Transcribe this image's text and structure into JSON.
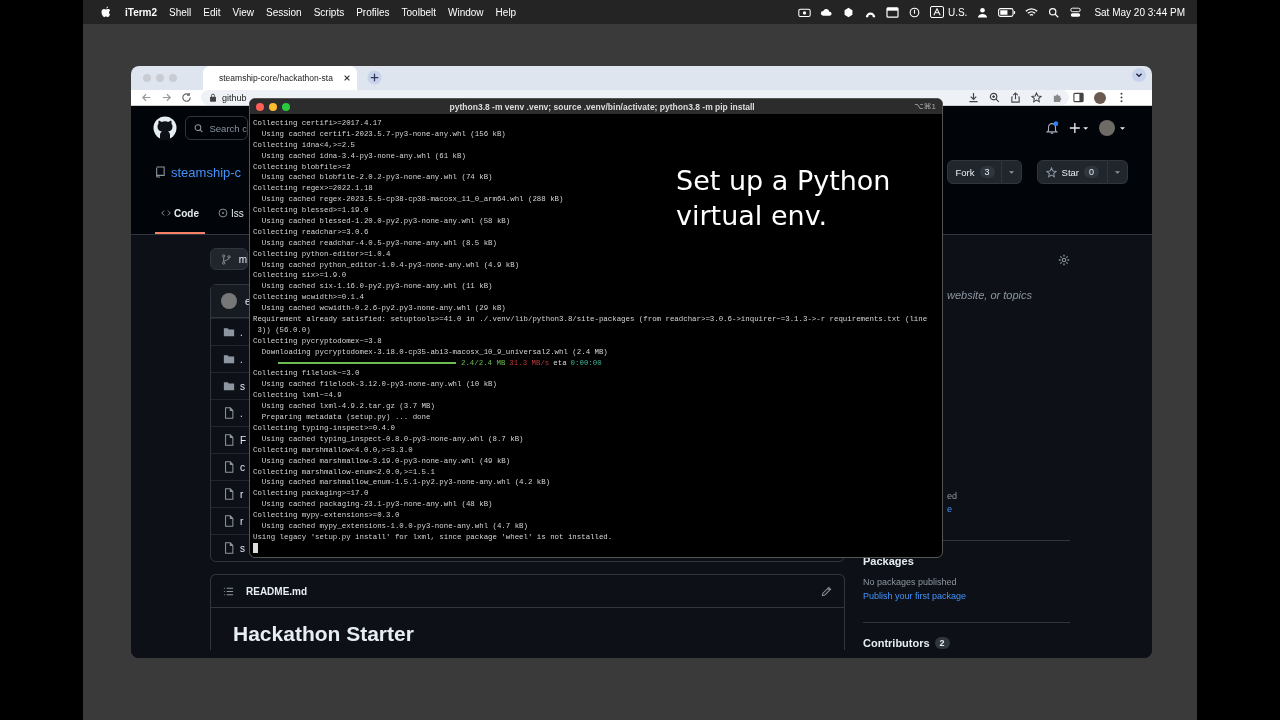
{
  "menubar": {
    "app": "iTerm2",
    "menus": [
      "Shell",
      "Edit",
      "View",
      "Session",
      "Scripts",
      "Profiles",
      "Toolbelt",
      "Window",
      "Help"
    ],
    "input_source": "U.S.",
    "clock": "Sat May 20  3:44 PM"
  },
  "browser": {
    "tab": {
      "title": "steamship-core/hackathon-sta",
      "selected": true
    },
    "address": "github"
  },
  "github": {
    "search": "Search c",
    "repo": "steamship-c",
    "tabs": [
      {
        "label": "Code",
        "selected": true
      },
      {
        "label": "Iss",
        "selected": false
      }
    ],
    "fork": {
      "label": "Fork",
      "count": "3"
    },
    "star": {
      "label": "Star",
      "count": "0"
    },
    "branch": "m",
    "commit_author": "e",
    "files": [
      {
        "kind": "folder",
        "name": "."
      },
      {
        "kind": "folder",
        "name": "."
      },
      {
        "kind": "folder",
        "name": "s"
      },
      {
        "kind": "file",
        "name": "."
      },
      {
        "kind": "file",
        "name": "F"
      },
      {
        "kind": "file",
        "name": "c"
      },
      {
        "kind": "file",
        "name": "r"
      },
      {
        "kind": "file",
        "name": "r"
      },
      {
        "kind": "file",
        "name": "s"
      }
    ],
    "about_text": "website, or topics",
    "releases_fragments": [
      "ed",
      "e"
    ],
    "readme": {
      "title": "README.md",
      "heading": "Hackathon Starter"
    },
    "packages": {
      "title": "Packages",
      "empty": "No packages published",
      "link": "Publish your first package"
    },
    "contributors": {
      "title": "Contributors",
      "count": "2"
    }
  },
  "terminal": {
    "title": "python3.8 -m venv .venv; source .venv/bin/activate; python3.8 -m pip install",
    "shortcut": "⌥⌘1",
    "lines": [
      {
        "kind": "text",
        "text": "Collecting certifi>=2017.4.17"
      },
      {
        "kind": "text",
        "text": "  Using cached certifi-2023.5.7-py3-none-any.whl (156 kB)"
      },
      {
        "kind": "text",
        "text": "Collecting idna<4,>=2.5"
      },
      {
        "kind": "text",
        "text": "  Using cached idna-3.4-py3-none-any.whl (61 kB)"
      },
      {
        "kind": "text",
        "text": "Collecting blobfile>=2"
      },
      {
        "kind": "text",
        "text": "  Using cached blobfile-2.0.2-py3-none-any.whl (74 kB)"
      },
      {
        "kind": "text",
        "text": "Collecting regex>=2022.1.18"
      },
      {
        "kind": "text",
        "text": "  Using cached regex-2023.5.5-cp38-cp38-macosx_11_0_arm64.whl (288 kB)"
      },
      {
        "kind": "text",
        "text": "Collecting blessed>=1.19.0"
      },
      {
        "kind": "text",
        "text": "  Using cached blessed-1.20.0-py2.py3-none-any.whl (58 kB)"
      },
      {
        "kind": "text",
        "text": "Collecting readchar>=3.0.6"
      },
      {
        "kind": "text",
        "text": "  Using cached readchar-4.0.5-py3-none-any.whl (8.5 kB)"
      },
      {
        "kind": "text",
        "text": "Collecting python-editor>=1.0.4"
      },
      {
        "kind": "text",
        "text": "  Using cached python_editor-1.0.4-py3-none-any.whl (4.9 kB)"
      },
      {
        "kind": "text",
        "text": "Collecting six>=1.9.0"
      },
      {
        "kind": "text",
        "text": "  Using cached six-1.16.0-py2.py3-none-any.whl (11 kB)"
      },
      {
        "kind": "text",
        "text": "Collecting wcwidth>=0.1.4"
      },
      {
        "kind": "text",
        "text": "  Using cached wcwidth-0.2.6-py2.py3-none-any.whl (29 kB)"
      },
      {
        "kind": "text",
        "text": "Requirement already satisfied: setuptools>=41.0 in ./.venv/lib/python3.8/site-packages (from readchar>=3.0.6->inquirer~=3.1.3->-r requirements.txt (line"
      },
      {
        "kind": "text",
        "text": " 3)) (56.0.0)"
      },
      {
        "kind": "text",
        "text": "Collecting pycryptodomex~=3.8"
      },
      {
        "kind": "text",
        "text": "  Downloading pycryptodomex-3.18.0-cp35-abi3-macosx_10_9_universal2.whl (2.4 MB)"
      },
      {
        "kind": "progress",
        "level": 1,
        "size": "2.4/2.4 MB",
        "speed": "31.3 MB/s",
        "eta_label": "eta",
        "eta": "0:00:00"
      },
      {
        "kind": "text",
        "text": "Collecting filelock~=3.0"
      },
      {
        "kind": "text",
        "text": "  Using cached filelock-3.12.0-py3-none-any.whl (10 kB)"
      },
      {
        "kind": "text",
        "text": "Collecting lxml~=4.9"
      },
      {
        "kind": "text",
        "text": "  Using cached lxml-4.9.2.tar.gz (3.7 MB)"
      },
      {
        "kind": "text",
        "text": "  Preparing metadata (setup.py) ... done"
      },
      {
        "kind": "text",
        "text": "Collecting typing-inspect>=0.4.0"
      },
      {
        "kind": "text",
        "text": "  Using cached typing_inspect-0.8.0-py3-none-any.whl (8.7 kB)"
      },
      {
        "kind": "text",
        "text": "Collecting marshmallow<4.0.0,>=3.3.0"
      },
      {
        "kind": "text",
        "text": "  Using cached marshmallow-3.19.0-py3-none-any.whl (49 kB)"
      },
      {
        "kind": "text",
        "text": "Collecting marshmallow-enum<2.0.0,>=1.5.1"
      },
      {
        "kind": "text",
        "text": "  Using cached marshmallow_enum-1.5.1-py2.py3-none-any.whl (4.2 kB)"
      },
      {
        "kind": "text",
        "text": "Collecting packaging>=17.0"
      },
      {
        "kind": "text",
        "text": "  Using cached packaging-23.1-py3-none-any.whl (48 kB)"
      },
      {
        "kind": "text",
        "text": "Collecting mypy-extensions>=0.3.0"
      },
      {
        "kind": "text",
        "text": "  Using cached mypy_extensions-1.0.0-py3-none-any.whl (4.7 kB)"
      },
      {
        "kind": "text",
        "text": "Using legacy 'setup.py install' for lxml, since package 'wheel' is not installed."
      },
      {
        "kind": "cursor"
      }
    ]
  },
  "caption": [
    "Set up a Python",
    "virtual env."
  ]
}
